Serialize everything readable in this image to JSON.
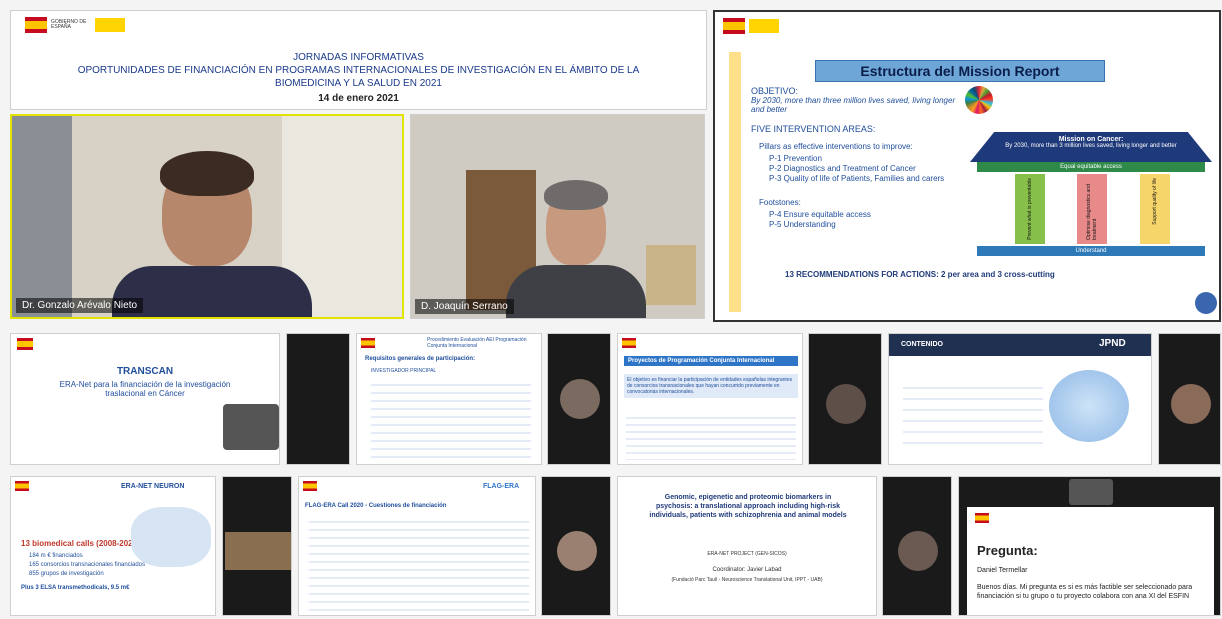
{
  "header_slide": {
    "line1": "JORNADAS INFORMATIVAS",
    "line2": "OPORTUNIDADES DE FINANCIACIÓN EN PROGRAMAS INTERNACIONALES DE INVESTIGACIÓN EN EL ÁMBITO DE LA",
    "line3": "BIOMEDICINA Y LA SALUD EN 2021",
    "date": "14 de enero 2021"
  },
  "speakers": {
    "left_name": "Dr. Gonzalo Arévalo Nieto",
    "right_name": "D. Joaquín Serrano"
  },
  "mission_slide": {
    "title": "Estructura del Mission Report",
    "objetivo_label": "OBJETIVO:",
    "objetivo_text": "By 2030, more than three million lives saved, living longer and better",
    "areas_label": "FIVE INTERVENTION AREAS:",
    "pillars_label": "Pillars as effective interventions to improve:",
    "p1": "P-1 Prevention",
    "p2": "P-2 Diagnostics and Treatment of Cancer",
    "p3": "P-3 Quality of life of Patients, Families and carers",
    "footstones_label": "Footstones:",
    "p4": "P-4 Ensure equitable access",
    "p5": "P-5 Understanding",
    "roof_title": "Mission on Cancer:",
    "roof_text": "By 2030, more than 3 million lives saved, living longer and better",
    "beam": "Equal equitable access",
    "base": "Understand",
    "col1": "Prevent what is preventable",
    "col2": "Optimise diagnostics and treatment",
    "col3": "Support quality of life",
    "recommendations": "13 RECOMMENDATIONS FOR ACTIONS: 2 per area and 3 cross-cutting"
  },
  "row2": {
    "transcan_title": "TRANSCAN",
    "transcan_sub": "ERA-Net para la financiación de la investigación traslacional en Cáncer",
    "s2_head": "Procedimiento Evaluación AEI Programación Conjunta Internacional",
    "s2_title": "Requisitos generales de participación:",
    "s2_sub": "INVESTIGADOR PRINCIPAL",
    "s3_title": "Proyectos de Programación Conjunta Internacional",
    "s3_text": "El objetivo es financiar la participación de entidades españolas integrantes de consorcios transnacionales que hayan concurrido previamente en convocatorias internacionales.",
    "s4_head": "CONTENIDO",
    "s4_logo": "JPND"
  },
  "row3": {
    "era_title": "ERA-NET NEURON",
    "era_big": "13 biomedical calls (2008-2020)",
    "era_l1": "184 m € financiados",
    "era_l2": "165 consorcios transnacionales financiados",
    "era_l3": "855 grupos de investigación",
    "era_plus": "Plus 3 ELSA transmethodicals, 9.5 m€",
    "flag_head": "FLAG-ERA Call 2020 - Cuestiones de financiación",
    "flag_logo": "FLAG-ERA",
    "genomic_title": "Genomic, epigenetic and proteomic biomarkers in psychosis: a translational approach including high-risk individuals, patients with schizophrenia and animal models",
    "genomic_project": "ERA-NET PROJECT (GEN-SICOS)",
    "genomic_coord": "Coordinator: Javier Labad",
    "genomic_inst": "(Fundació Parc Taulí - Neuroscience Translational Unit, IPPT - UAB)",
    "pregunta_title": "Pregunta:",
    "pregunta_name": "Daniel Termellar",
    "pregunta_text": "Buenos días. Mi pregunta es si es más factible ser seleccionado para financiación si tu grupo o tu proyecto colabora con ana XI del ESFIN"
  }
}
